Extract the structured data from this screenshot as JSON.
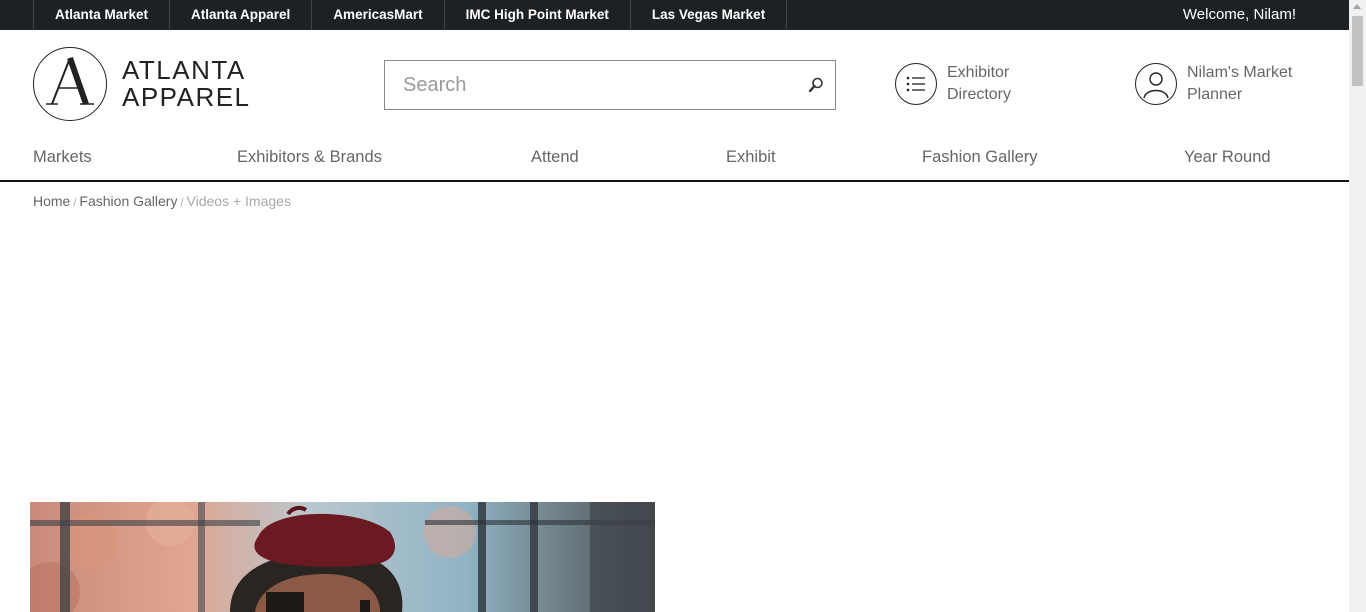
{
  "topbar": {
    "links": [
      "Atlanta Market",
      "Atlanta Apparel",
      "AmericasMart",
      "IMC High Point Market",
      "Las Vegas Market"
    ],
    "welcome": "Welcome, Nilam!"
  },
  "logo": {
    "line1": "ATLANTA",
    "line2": "APPAREL"
  },
  "search": {
    "placeholder": "Search"
  },
  "utility": {
    "directory_line1": "Exhibitor",
    "directory_line2": "Directory",
    "planner_line1": "Nilam's Market",
    "planner_line2": "Planner"
  },
  "nav": [
    "Markets",
    "Exhibitors & Brands",
    "Attend",
    "Exhibit",
    "Fashion Gallery",
    "Year Round"
  ],
  "breadcrumb": {
    "home": "Home",
    "section": "Fashion Gallery",
    "current": "Videos + Images"
  },
  "colors": {
    "topbar_bg": "#1e2124",
    "nav_text": "#666666",
    "beret": "#6b1a22"
  }
}
